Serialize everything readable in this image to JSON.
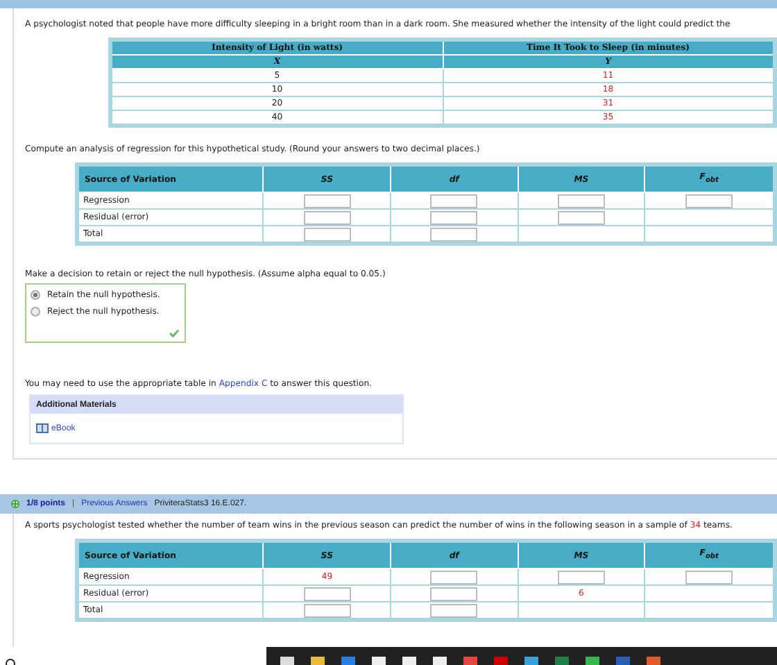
{
  "question1": {
    "prompt": "A psychologist noted that people have more difficulty sleeping in a bright room than in a dark room. She measured whether the intensity of the light could predict the",
    "data_table": {
      "headers": [
        "Intensity of Light (in watts)",
        "Time It Took to Sleep (in minutes)"
      ],
      "symbols": [
        "X",
        "Y"
      ],
      "rows": [
        [
          "5",
          "11"
        ],
        [
          "10",
          "18"
        ],
        [
          "20",
          "31"
        ],
        [
          "40",
          "35"
        ]
      ]
    },
    "instruction": "Compute an analysis of regression for this hypothetical study. (Round your answers to two decimal places.)",
    "anova": {
      "columns": [
        "Source of Variation",
        "SS",
        "df",
        "MS",
        "F$_{obt}$"
      ],
      "rows": [
        {
          "cells": [
            {
              "kind": "label",
              "text": "Regression"
            },
            {
              "kind": "input"
            },
            {
              "kind": "input"
            },
            {
              "kind": "input"
            },
            {
              "kind": "input"
            }
          ]
        },
        {
          "cells": [
            {
              "kind": "label",
              "text": "Residual (error)"
            },
            {
              "kind": "input"
            },
            {
              "kind": "input"
            },
            {
              "kind": "input"
            },
            {
              "kind": "empty"
            }
          ]
        },
        {
          "cells": [
            {
              "kind": "label",
              "text": "Total"
            },
            {
              "kind": "input"
            },
            {
              "kind": "input"
            },
            {
              "kind": "empty"
            },
            {
              "kind": "empty"
            }
          ]
        }
      ]
    },
    "decision": {
      "prompt": "Make a decision to retain or reject the null hypothesis. (Assume alpha equal to 0.05.)",
      "correct": true,
      "options": [
        {
          "label": "Retain the null hypothesis.",
          "selected": true
        },
        {
          "label": "Reject the null hypothesis.",
          "selected": false
        }
      ]
    },
    "appendix_note": {
      "before": "You may need to use the appropriate table in ",
      "link": "Appendix C",
      "after": " to answer this question."
    },
    "materials": {
      "title": "Additional Materials",
      "links": [
        "eBook"
      ]
    }
  },
  "question2": {
    "header": {
      "points": "1/8 points",
      "separator": "|",
      "previous": "Previous Answers",
      "source": "PriviteraStats3 16.E.027."
    },
    "prompt": {
      "before": "A sports psychologist tested whether the number of team wins in the previous season can predict the number of wins in the following season in a sample of ",
      "value": "34",
      "after": " teams."
    },
    "anova": {
      "columns": [
        "Source of Variation",
        "SS",
        "df",
        "MS",
        "F$_{obt}$"
      ],
      "rows": [
        {
          "cells": [
            {
              "kind": "label",
              "text": "Regression"
            },
            {
              "kind": "value",
              "text": "49"
            },
            {
              "kind": "input"
            },
            {
              "kind": "input"
            },
            {
              "kind": "input"
            }
          ]
        },
        {
          "cells": [
            {
              "kind": "label",
              "text": "Residual (error)"
            },
            {
              "kind": "input"
            },
            {
              "kind": "input"
            },
            {
              "kind": "value",
              "text": "6"
            },
            {
              "kind": "empty"
            }
          ]
        },
        {
          "cells": [
            {
              "kind": "label",
              "text": "Total"
            },
            {
              "kind": "input"
            },
            {
              "kind": "input"
            },
            {
              "kind": "empty"
            },
            {
              "kind": "empty"
            }
          ]
        }
      ]
    }
  }
}
